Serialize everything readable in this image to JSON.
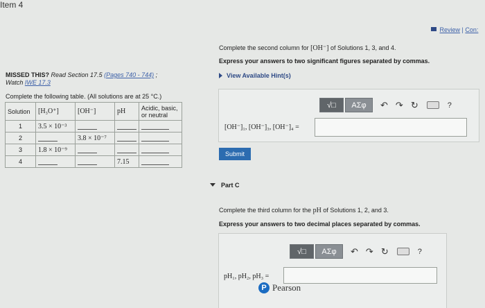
{
  "page": {
    "item_title": "Item 4",
    "review_link": "Review",
    "constants_link": "Con:",
    "review_separator": "|"
  },
  "left": {
    "missed_label": "MISSED THIS?",
    "missed_read": " Read Section 17.5 ",
    "pages_link": "(Pages 740 - 744)",
    "missed_suffix": " ;",
    "watch_text": "Watch ",
    "watch_link": "IWE 17.3",
    "table_intro": "Complete the following table. (All solutions are at 25 °C.)",
    "table": {
      "headers": [
        "Solution",
        "[H₃O⁺]",
        "[OH⁻]",
        "pH",
        "Acidic, basic, or neutral"
      ],
      "rows": [
        {
          "solution": "1",
          "h3o": "3.5 × 10⁻³",
          "oh": "",
          "ph": "",
          "nature": ""
        },
        {
          "solution": "2",
          "h3o": "",
          "oh": "3.8 × 10⁻⁷",
          "ph": "",
          "nature": ""
        },
        {
          "solution": "3",
          "h3o": "1.8 × 10⁻⁹",
          "oh": "",
          "ph": "",
          "nature": ""
        },
        {
          "solution": "4",
          "h3o": "",
          "oh": "",
          "ph": "7.15",
          "nature": ""
        }
      ]
    }
  },
  "partB": {
    "prompt_pre": "Complete the second column for ",
    "prompt_species": "[OH⁻]",
    "prompt_post": " of Solutions 1, 3, and 4.",
    "instruction": "Express your answers to two significant figures separated by commas.",
    "hints_label": "View Available Hint(s)",
    "toolbar": {
      "templates": "√□",
      "symbols": "AΣφ",
      "help": "?"
    },
    "answer_label": "[OH⁻]₁, [OH⁻]₃, [OH⁻]₄ =",
    "answer_value": "",
    "submit_label": "Submit"
  },
  "partC": {
    "title": "Part C",
    "prompt_pre": "Complete the third column for the ",
    "prompt_var": "pH",
    "prompt_post": " of Solutions 1, 2, and 3.",
    "instruction": "Express your answers to two decimal places separated by commas.",
    "toolbar": {
      "templates": "√□",
      "symbols": "AΣφ",
      "help": "?"
    },
    "answer_label": "pH₁, pH₂, pH₃ =",
    "answer_value": ""
  },
  "footer": {
    "brand_letter": "P",
    "brand_name": "Pearson"
  },
  "colors": {
    "accent_blue": "#2c6cb0",
    "link_blue": "#3b5fa8",
    "background": "#e6e8e6"
  }
}
